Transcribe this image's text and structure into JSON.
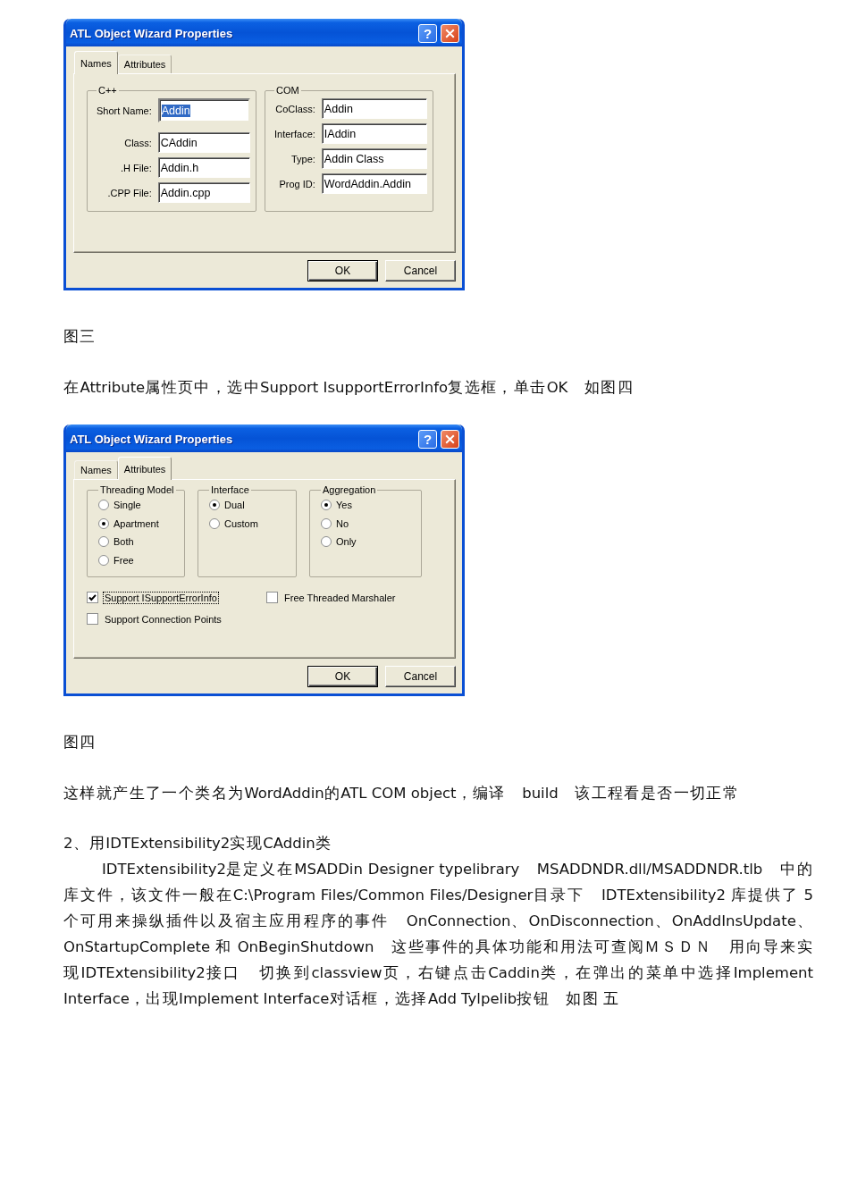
{
  "document": [
    {
      "kind": "dialog",
      "title": "ATL Object Wizard Properties",
      "help_button": "?",
      "tabs": [
        {
          "label": "Names",
          "selected": true
        },
        {
          "label": "Attributes",
          "selected": false
        }
      ],
      "page": {
        "kind": "names",
        "groups": [
          {
            "title": "C++",
            "fields": [
              {
                "label": "Short Name:",
                "value": "Addin",
                "focused": true
              },
              {
                "label": "Class:",
                "value": "CAddin",
                "focused": false
              },
              {
                "label": ".H File:",
                "value": "Addin.h",
                "focused": false
              },
              {
                "label": ".CPP File:",
                "value": "Addin.cpp",
                "focused": false
              }
            ]
          },
          {
            "title": "COM",
            "fields": [
              {
                "label": "CoClass:",
                "value": "Addin",
                "focused": false
              },
              {
                "label": "Interface:",
                "value": "IAddin",
                "focused": false
              },
              {
                "label": "Type:",
                "value": "Addin Class",
                "focused": false
              },
              {
                "label": "Prog ID:",
                "value": "WordAddin.Addin",
                "focused": false
              }
            ]
          }
        ]
      },
      "buttons": [
        {
          "label": "OK",
          "default": true
        },
        {
          "label": "Cancel",
          "default": false
        }
      ]
    },
    {
      "kind": "caption",
      "text": "图三"
    },
    {
      "kind": "paragraph",
      "indent": false,
      "text": "在Attribute属性页中，选中Support IsupportErrorInfo复选框，单击OK　如图四"
    },
    {
      "kind": "dialog",
      "title": "ATL Object Wizard Properties",
      "help_button": "?",
      "tabs": [
        {
          "label": "Names",
          "selected": false
        },
        {
          "label": "Attributes",
          "selected": true
        }
      ],
      "page": {
        "kind": "attributes",
        "groups": [
          {
            "title": "Threading Model",
            "options": [
              {
                "label": "Single",
                "selected": false
              },
              {
                "label": "Apartment",
                "selected": true
              },
              {
                "label": "Both",
                "selected": false
              },
              {
                "label": "Free",
                "selected": false
              }
            ]
          },
          {
            "title": "Interface",
            "options": [
              {
                "label": "Dual",
                "selected": true
              },
              {
                "label": "Custom",
                "selected": false
              }
            ]
          },
          {
            "title": "Aggregation",
            "options": [
              {
                "label": "Yes",
                "selected": true
              },
              {
                "label": "No",
                "selected": false
              },
              {
                "label": "Only",
                "selected": false
              }
            ]
          }
        ],
        "checkboxes": [
          {
            "label": "Support ISupportErrorInfo",
            "checked": true,
            "focused": true
          },
          {
            "label": "Free Threaded Marshaler",
            "checked": false,
            "focused": false
          },
          {
            "label": "Support Connection Points",
            "checked": false,
            "focused": false
          }
        ]
      },
      "buttons": [
        {
          "label": "OK",
          "default": true
        },
        {
          "label": "Cancel",
          "default": false
        }
      ]
    },
    {
      "kind": "caption",
      "text": "图四"
    },
    {
      "kind": "paragraph",
      "indent": false,
      "text": "这样就产生了一个类名为WordAddin的ATL COM object，编译　build　该工程看是否一切正常"
    },
    {
      "kind": "heading",
      "text": "2、用IDTExtensibility2实现CAddin类"
    },
    {
      "kind": "paragraph",
      "indent": true,
      "text": "IDTExtensibility2是定义在MSADDin Designer typelibrary　MSADDNDR.dll/MSADDNDR.tlb　中的库文件，该文件一般在C:\\Program Files/Common Files/Designer目录下　IDTExtensibility2 库提供了 5 个可用来操纵插件以及宿主应用程序的事件　OnConnection、OnDisconnection、OnAddInsUpdate、OnStartupComplete 和 OnBeginShutdown　这些事件的具体功能和用法可查阅ＭＳＤＮ　用向导来实现IDTExtensibility2接口　切换到classview页，右键点击Caddin类，在弹出的菜单中选择Implement Interface，出现Implement Interface对话框，选择Add Tylpelib按钮　如图 五"
    }
  ]
}
